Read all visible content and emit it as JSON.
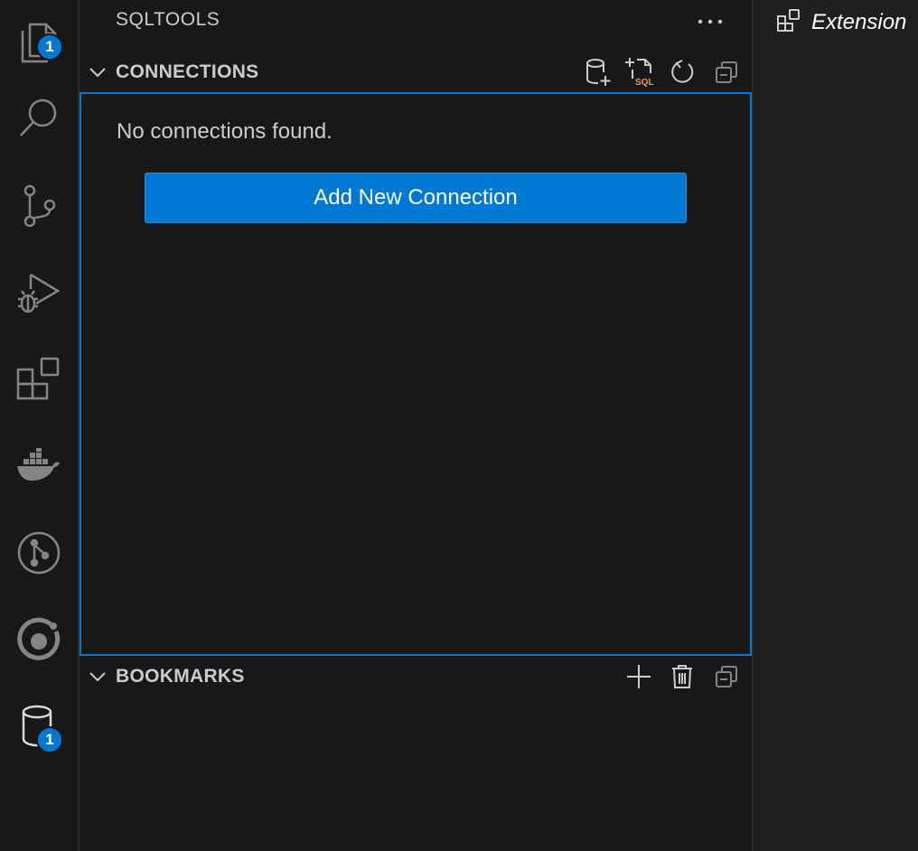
{
  "activity_bar": {
    "explorer_badge": "1",
    "sqltools_badge": "1"
  },
  "sidebar": {
    "title": "SQLTOOLS",
    "more_label": "···",
    "connections": {
      "title": "CONNECTIONS",
      "empty_message": "No connections found.",
      "add_button_label": "Add New Connection",
      "sql_icon_text": "SQL"
    },
    "bookmarks": {
      "title": "BOOKMARKS"
    }
  },
  "editor": {
    "tab_label": "Extension"
  },
  "colors": {
    "accent": "#0078d4",
    "background": "#181818",
    "foreground": "#cccccc",
    "sql_icon": "#e8a33a"
  }
}
